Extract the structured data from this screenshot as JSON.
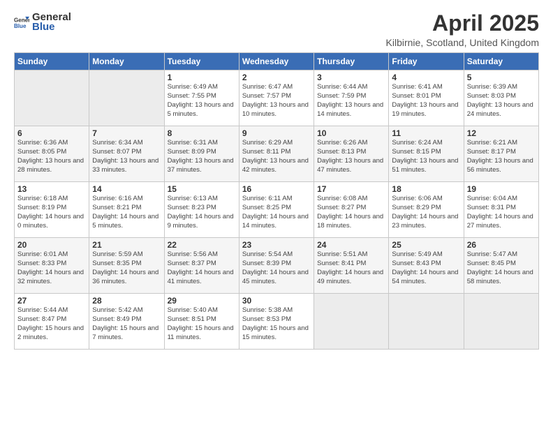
{
  "header": {
    "logo_general": "General",
    "logo_blue": "Blue",
    "title": "April 2025",
    "subtitle": "Kilbirnie, Scotland, United Kingdom"
  },
  "days_of_week": [
    "Sunday",
    "Monday",
    "Tuesday",
    "Wednesday",
    "Thursday",
    "Friday",
    "Saturday"
  ],
  "weeks": [
    [
      {
        "day": "",
        "info": ""
      },
      {
        "day": "",
        "info": ""
      },
      {
        "day": "1",
        "info": "Sunrise: 6:49 AM\nSunset: 7:55 PM\nDaylight: 13 hours and 5 minutes."
      },
      {
        "day": "2",
        "info": "Sunrise: 6:47 AM\nSunset: 7:57 PM\nDaylight: 13 hours and 10 minutes."
      },
      {
        "day": "3",
        "info": "Sunrise: 6:44 AM\nSunset: 7:59 PM\nDaylight: 13 hours and 14 minutes."
      },
      {
        "day": "4",
        "info": "Sunrise: 6:41 AM\nSunset: 8:01 PM\nDaylight: 13 hours and 19 minutes."
      },
      {
        "day": "5",
        "info": "Sunrise: 6:39 AM\nSunset: 8:03 PM\nDaylight: 13 hours and 24 minutes."
      }
    ],
    [
      {
        "day": "6",
        "info": "Sunrise: 6:36 AM\nSunset: 8:05 PM\nDaylight: 13 hours and 28 minutes."
      },
      {
        "day": "7",
        "info": "Sunrise: 6:34 AM\nSunset: 8:07 PM\nDaylight: 13 hours and 33 minutes."
      },
      {
        "day": "8",
        "info": "Sunrise: 6:31 AM\nSunset: 8:09 PM\nDaylight: 13 hours and 37 minutes."
      },
      {
        "day": "9",
        "info": "Sunrise: 6:29 AM\nSunset: 8:11 PM\nDaylight: 13 hours and 42 minutes."
      },
      {
        "day": "10",
        "info": "Sunrise: 6:26 AM\nSunset: 8:13 PM\nDaylight: 13 hours and 47 minutes."
      },
      {
        "day": "11",
        "info": "Sunrise: 6:24 AM\nSunset: 8:15 PM\nDaylight: 13 hours and 51 minutes."
      },
      {
        "day": "12",
        "info": "Sunrise: 6:21 AM\nSunset: 8:17 PM\nDaylight: 13 hours and 56 minutes."
      }
    ],
    [
      {
        "day": "13",
        "info": "Sunrise: 6:18 AM\nSunset: 8:19 PM\nDaylight: 14 hours and 0 minutes."
      },
      {
        "day": "14",
        "info": "Sunrise: 6:16 AM\nSunset: 8:21 PM\nDaylight: 14 hours and 5 minutes."
      },
      {
        "day": "15",
        "info": "Sunrise: 6:13 AM\nSunset: 8:23 PM\nDaylight: 14 hours and 9 minutes."
      },
      {
        "day": "16",
        "info": "Sunrise: 6:11 AM\nSunset: 8:25 PM\nDaylight: 14 hours and 14 minutes."
      },
      {
        "day": "17",
        "info": "Sunrise: 6:08 AM\nSunset: 8:27 PM\nDaylight: 14 hours and 18 minutes."
      },
      {
        "day": "18",
        "info": "Sunrise: 6:06 AM\nSunset: 8:29 PM\nDaylight: 14 hours and 23 minutes."
      },
      {
        "day": "19",
        "info": "Sunrise: 6:04 AM\nSunset: 8:31 PM\nDaylight: 14 hours and 27 minutes."
      }
    ],
    [
      {
        "day": "20",
        "info": "Sunrise: 6:01 AM\nSunset: 8:33 PM\nDaylight: 14 hours and 32 minutes."
      },
      {
        "day": "21",
        "info": "Sunrise: 5:59 AM\nSunset: 8:35 PM\nDaylight: 14 hours and 36 minutes."
      },
      {
        "day": "22",
        "info": "Sunrise: 5:56 AM\nSunset: 8:37 PM\nDaylight: 14 hours and 41 minutes."
      },
      {
        "day": "23",
        "info": "Sunrise: 5:54 AM\nSunset: 8:39 PM\nDaylight: 14 hours and 45 minutes."
      },
      {
        "day": "24",
        "info": "Sunrise: 5:51 AM\nSunset: 8:41 PM\nDaylight: 14 hours and 49 minutes."
      },
      {
        "day": "25",
        "info": "Sunrise: 5:49 AM\nSunset: 8:43 PM\nDaylight: 14 hours and 54 minutes."
      },
      {
        "day": "26",
        "info": "Sunrise: 5:47 AM\nSunset: 8:45 PM\nDaylight: 14 hours and 58 minutes."
      }
    ],
    [
      {
        "day": "27",
        "info": "Sunrise: 5:44 AM\nSunset: 8:47 PM\nDaylight: 15 hours and 2 minutes."
      },
      {
        "day": "28",
        "info": "Sunrise: 5:42 AM\nSunset: 8:49 PM\nDaylight: 15 hours and 7 minutes."
      },
      {
        "day": "29",
        "info": "Sunrise: 5:40 AM\nSunset: 8:51 PM\nDaylight: 15 hours and 11 minutes."
      },
      {
        "day": "30",
        "info": "Sunrise: 5:38 AM\nSunset: 8:53 PM\nDaylight: 15 hours and 15 minutes."
      },
      {
        "day": "",
        "info": ""
      },
      {
        "day": "",
        "info": ""
      },
      {
        "day": "",
        "info": ""
      }
    ]
  ]
}
